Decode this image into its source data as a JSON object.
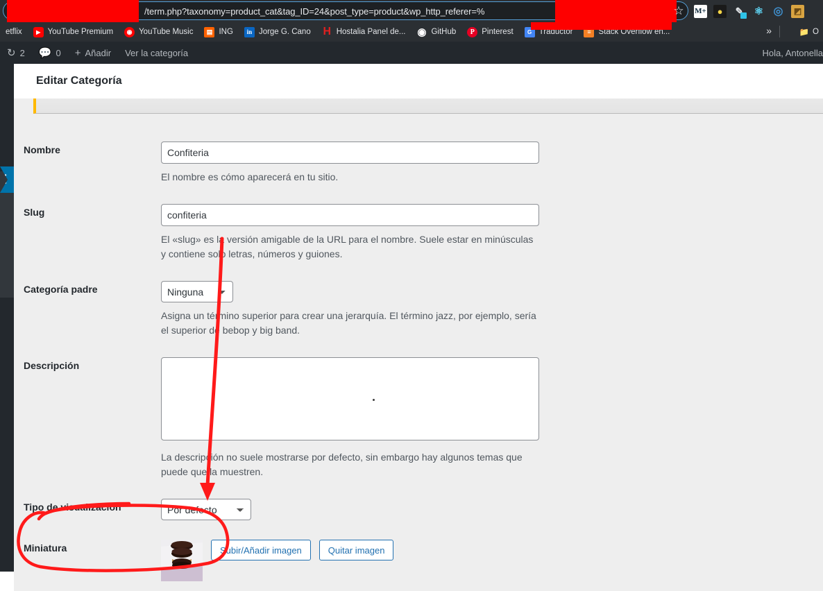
{
  "browser": {
    "url": "/term.php?taxonomy=product_cat&tag_ID=24&post_type=product&wp_http_referer=%",
    "star_icon": "☆",
    "extensions": [
      {
        "name": "movistar-extension-icon",
        "glyph": "M+"
      },
      {
        "name": "bulb-extension-icon",
        "glyph": "●"
      },
      {
        "name": "marker-extension-icon",
        "glyph": "✒"
      },
      {
        "name": "react-devtools-icon",
        "glyph": "⚛"
      },
      {
        "name": "opera-ring-extension-icon",
        "glyph": "◎"
      },
      {
        "name": "tan-extension-icon",
        "glyph": "◩"
      }
    ],
    "bookmarks": [
      {
        "label": "etflix",
        "icon": "netflix-icon",
        "glyph": ""
      },
      {
        "label": "YouTube Premium",
        "icon": "youtube-premium-icon",
        "glyph": "▶"
      },
      {
        "label": "YouTube Music",
        "icon": "youtube-music-icon",
        "glyph": "◉"
      },
      {
        "label": "ING",
        "icon": "ing-icon",
        "glyph": "▤"
      },
      {
        "label": "Jorge G. Cano",
        "icon": "linkedin-icon",
        "glyph": "in"
      },
      {
        "label": "Hostalia Panel de...",
        "icon": "hostalia-icon",
        "glyph": "H"
      },
      {
        "label": "GitHub",
        "icon": "github-icon",
        "glyph": "●"
      },
      {
        "label": "Pinterest",
        "icon": "pinterest-icon",
        "glyph": "P"
      },
      {
        "label": "Traductor",
        "icon": "google-translate-icon",
        "glyph": "G"
      },
      {
        "label": "Stack Overflow en...",
        "icon": "stackoverflow-icon",
        "glyph": "≡"
      }
    ],
    "overflow_label": "»",
    "folder_label": "O",
    "folder_icon": "folder-icon"
  },
  "adminbar": {
    "updates_icon": "updates-icon",
    "updates_count": "2",
    "comments_icon": "comments-icon",
    "comments_count": "0",
    "new_icon": "plus-icon",
    "new_label": "Añadir",
    "view_label": "Ver la categoría",
    "greeting": "Hola, Antonella"
  },
  "page": {
    "title": "Editar Categoría"
  },
  "form": {
    "name": {
      "label": "Nombre",
      "value": "Confiteria",
      "description": "El nombre es cómo aparecerá en tu sitio."
    },
    "slug": {
      "label": "Slug",
      "value": "confiteria",
      "description": "El «slug» es la versión amigable de la URL para el nombre. Suele estar en minúsculas y contiene solo letras, números y guiones."
    },
    "parent": {
      "label": "Categoría padre",
      "selected": "Ninguna",
      "options": [
        "Ninguna"
      ],
      "description": "Asigna un término superior para crear una jerarquía. El término jazz, por ejemplo, sería el superior de bebop y big band."
    },
    "description": {
      "label": "Descripción",
      "value": "",
      "description": "La descripción no suele mostrarse por defecto, sin embargo hay algunos temas que puede que la muestren."
    },
    "display_type": {
      "label": "Tipo de visualización",
      "selected": "Por defecto",
      "options": [
        "Por defecto"
      ]
    },
    "thumbnail": {
      "label": "Miniatura",
      "image_alt": "alfajores-de-chocolate-thumbnail",
      "upload_label": "Subir/Añadir imagen",
      "remove_label": "Quitar imagen"
    }
  },
  "colors": {
    "annotation": "#ff1a1a",
    "redaction": "#fe0000",
    "wp_blue": "#2271b1",
    "admin_dark": "#23282d",
    "notice_accent": "#ffb900"
  }
}
